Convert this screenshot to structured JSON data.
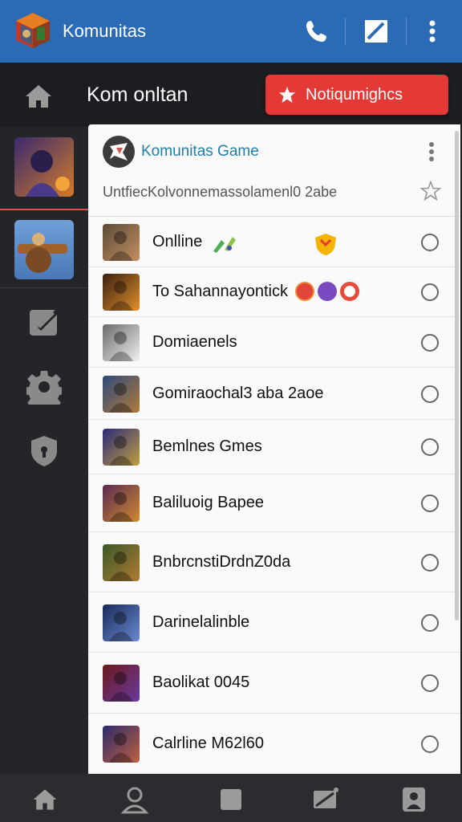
{
  "app": {
    "title": "Komunitas",
    "logo_icon": "game-cube-logo",
    "bar_color": "#2b6bb6"
  },
  "appbar_actions": [
    {
      "icon": "phone-icon"
    },
    {
      "icon": "compose-icon"
    },
    {
      "icon": "more-vertical-icon"
    }
  ],
  "subheader": {
    "title": "Kom onltan",
    "home_icon": "home-icon",
    "notify_button": {
      "label": "Notiqumighcs",
      "icon": "star-icon",
      "color": "#e53935"
    }
  },
  "rail": {
    "games": [
      {
        "name": "purple-knight-game",
        "colors": [
          "#3a2a6e",
          "#d27a2a"
        ]
      },
      {
        "name": "gunner-game",
        "colors": [
          "#4a78b8",
          "#a0622c"
        ]
      }
    ],
    "icons": [
      "edit-icon",
      "settings-gear-icon",
      "shield-icon"
    ]
  },
  "panel": {
    "title": "Komunitas Game",
    "subtitle": "UntfiecKolvonnemassolamenl0 2abe",
    "menu_icon": "more-vertical-icon",
    "star_icon": "star-outline-icon",
    "rows": [
      {
        "label": "Onlline",
        "thumb": [
          "#5a4a38",
          "#c49060"
        ],
        "extras": [
          "pencil-leaf-emoji",
          "shield-emoji"
        ]
      },
      {
        "label": "To Sahannayontick",
        "thumb": [
          "#3a1f12",
          "#e0902a"
        ],
        "extras": [
          "red-badge",
          "purple-badge",
          "red-ring-badge"
        ]
      },
      {
        "label": "Domiaenels",
        "thumb": [
          "#6a6a6a",
          "#f0f0f0"
        ],
        "extras": []
      },
      {
        "label": "Gomiraochal3 aba 2aoe",
        "thumb": [
          "#2d4a7a",
          "#b07a3a"
        ],
        "extras": []
      },
      {
        "label": "Bemlnes Gmes",
        "thumb": [
          "#2c2a78",
          "#c0a040"
        ],
        "extras": []
      },
      {
        "label": "Baliluoig Bapee",
        "thumb": [
          "#5a2a50",
          "#d08a30"
        ],
        "extras": []
      },
      {
        "label": "BnbrcnstiDrdnZ0da",
        "thumb": [
          "#3a5a2a",
          "#b07a30"
        ],
        "extras": []
      },
      {
        "label": "Darinelalinble",
        "thumb": [
          "#1a2a5a",
          "#6a8ad0"
        ],
        "extras": []
      },
      {
        "label": "Baolikat 0045",
        "thumb": [
          "#6a1a1a",
          "#6a3aa0"
        ],
        "extras": []
      },
      {
        "label": "Calrline M62l60",
        "thumb": [
          "#2a2a6a",
          "#c06040"
        ],
        "extras": []
      }
    ]
  },
  "bottom_nav": [
    {
      "icon": "home-icon"
    },
    {
      "icon": "profile-icon"
    },
    {
      "icon": "square-icon"
    },
    {
      "icon": "message-icon"
    },
    {
      "icon": "account-lock-icon"
    }
  ]
}
